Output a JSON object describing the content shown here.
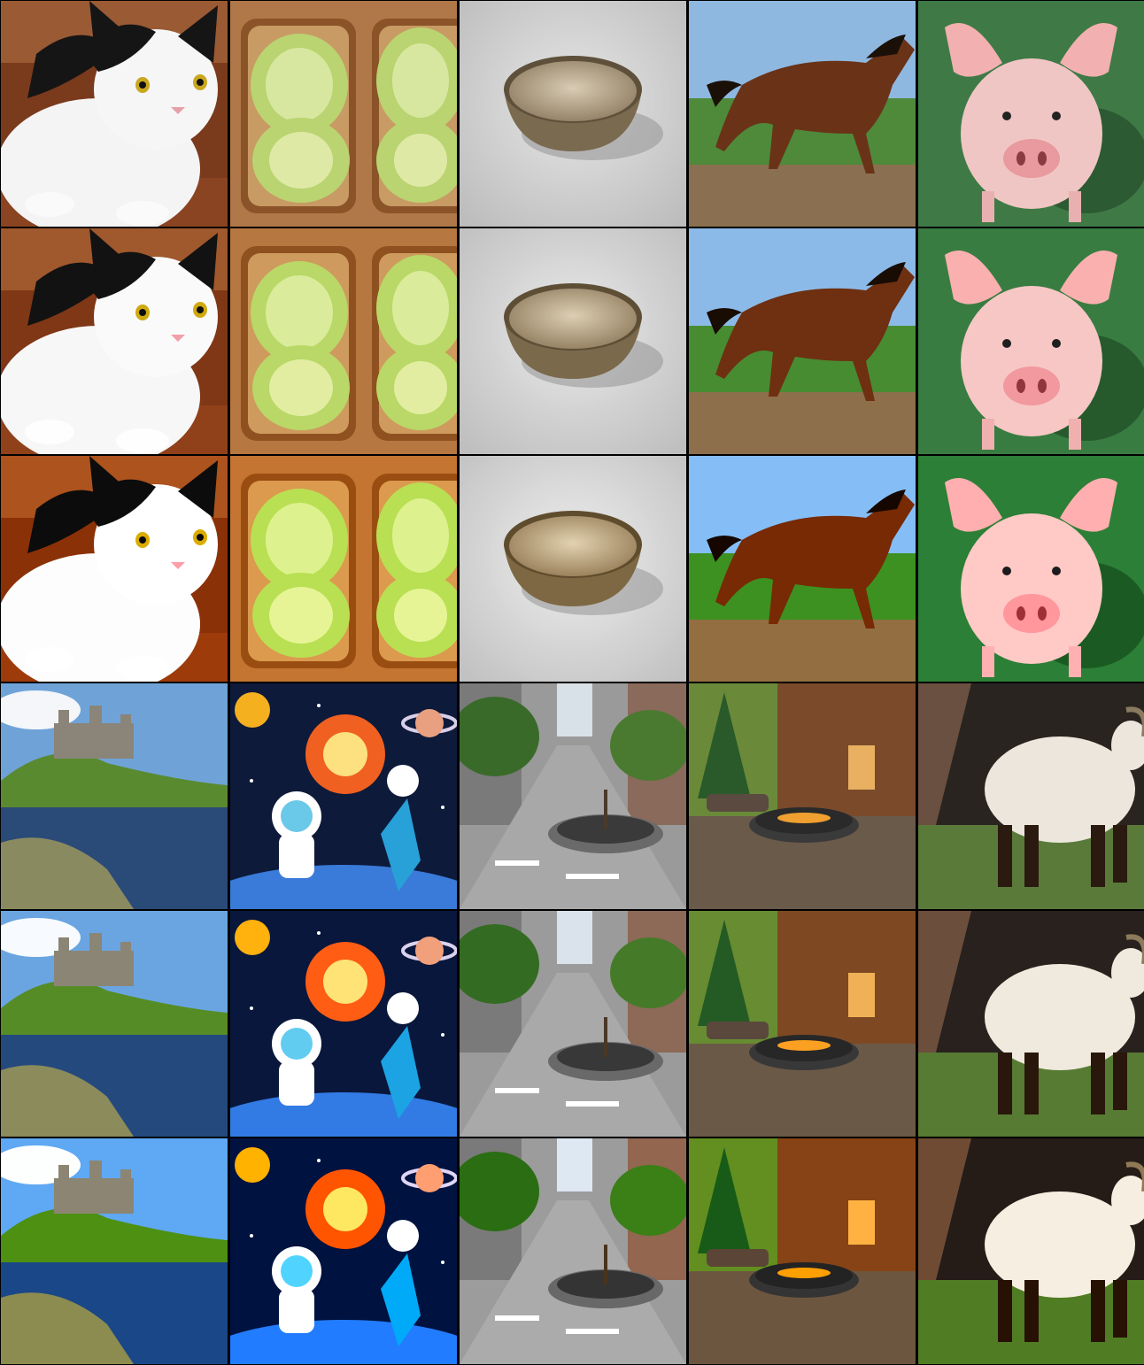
{
  "grid": {
    "rows": 6,
    "columns": 5,
    "palette": {
      "cat_bg": "#7a3a1c",
      "toast_bg": "#b07848",
      "bowl_bg": "#cfcfcf",
      "horse_sky": "#8fb8e0",
      "horse_grass": "#4e8a3a",
      "pig_bg": "#3f7a46",
      "castle_sky": "#6fa3d8",
      "space_bg": "#0d1a3a",
      "city_road": "#9a9a9a",
      "cabin_bg": "#5a3a24",
      "goat_bg": "#2a2420"
    }
  },
  "tiles": [
    {
      "subject": "cat-icon"
    },
    {
      "subject": "avocado-toast-icon"
    },
    {
      "subject": "bowl-icon"
    },
    {
      "subject": "horse-icon"
    },
    {
      "subject": "pig-icon"
    },
    {
      "subject": "castle-icon"
    },
    {
      "subject": "astronaut-icon"
    },
    {
      "subject": "city-street-icon"
    },
    {
      "subject": "fire-pit-icon"
    },
    {
      "subject": "goat-icon"
    }
  ]
}
